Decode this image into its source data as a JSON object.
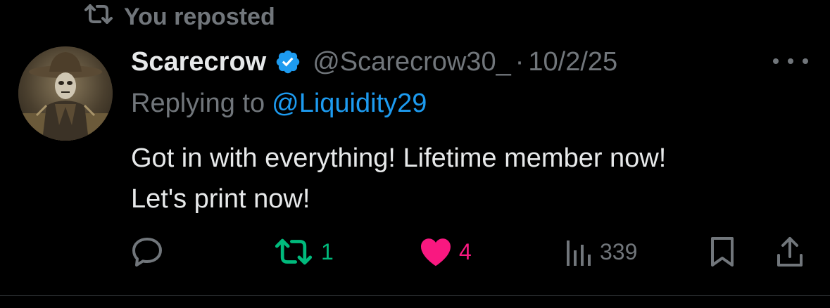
{
  "repost_banner": {
    "icon": "repost-icon",
    "text": "You reposted"
  },
  "tweet": {
    "author": {
      "name": "Scarecrow",
      "verified_icon": "verified-badge-icon",
      "handle": "@Scarecrow30_",
      "separator": "·",
      "date": "10/2/25"
    },
    "more_icon": "more-options-icon",
    "reply_prefix": "Replying to",
    "reply_mention": "@Liquidity29",
    "text_lines": [
      "Got in with everything! Lifetime member now!",
      "Let's print now!"
    ]
  },
  "actions": {
    "reply": {
      "icon": "reply-icon"
    },
    "repost": {
      "icon": "repost-icon",
      "count": "1",
      "color": "#00ba7c"
    },
    "like": {
      "icon": "heart-icon",
      "count": "4",
      "color": "#f91880"
    },
    "views": {
      "icon": "views-icon",
      "count": "339"
    },
    "bookmark": {
      "icon": "bookmark-icon"
    },
    "share": {
      "icon": "share-icon"
    }
  },
  "colors": {
    "background": "#000000",
    "text": "#e7e9ea",
    "secondary": "#71767b",
    "link": "#1d9bf0",
    "repost_active": "#00ba7c",
    "like_active": "#f91880"
  }
}
